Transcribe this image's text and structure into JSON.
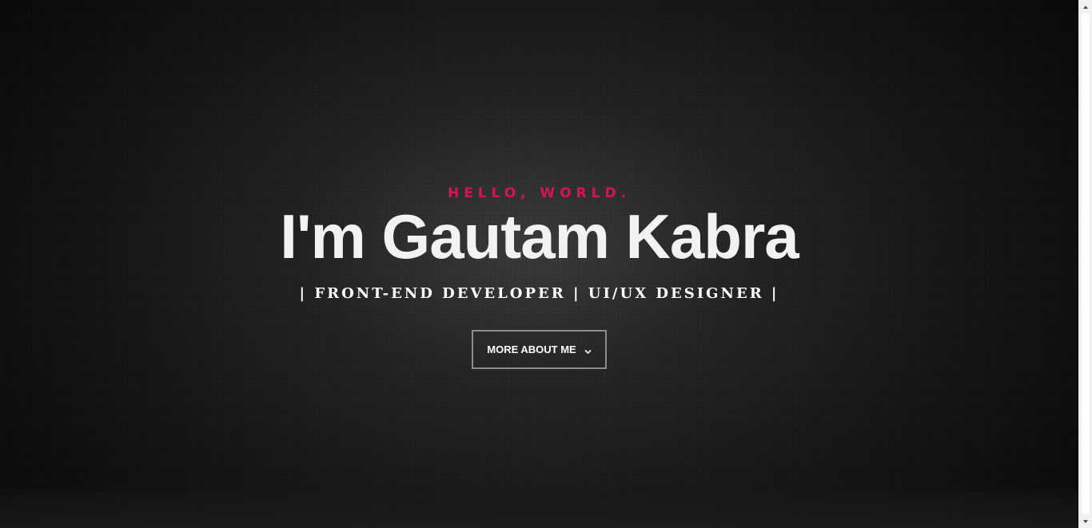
{
  "hero": {
    "eyebrow": "HELLO, WORLD.",
    "title": "I'm Gautam Kabra",
    "subtitle": "| FRONT-END DEVELOPER | UI/UX DESIGNER |",
    "cta_label": "MORE ABOUT ME",
    "cta_icon": "chevron-down-icon"
  },
  "colors": {
    "accent": "#d3174e",
    "title": "#f2f2f2",
    "background": "#1a1a1a",
    "button_border": "#8c8c8c"
  }
}
